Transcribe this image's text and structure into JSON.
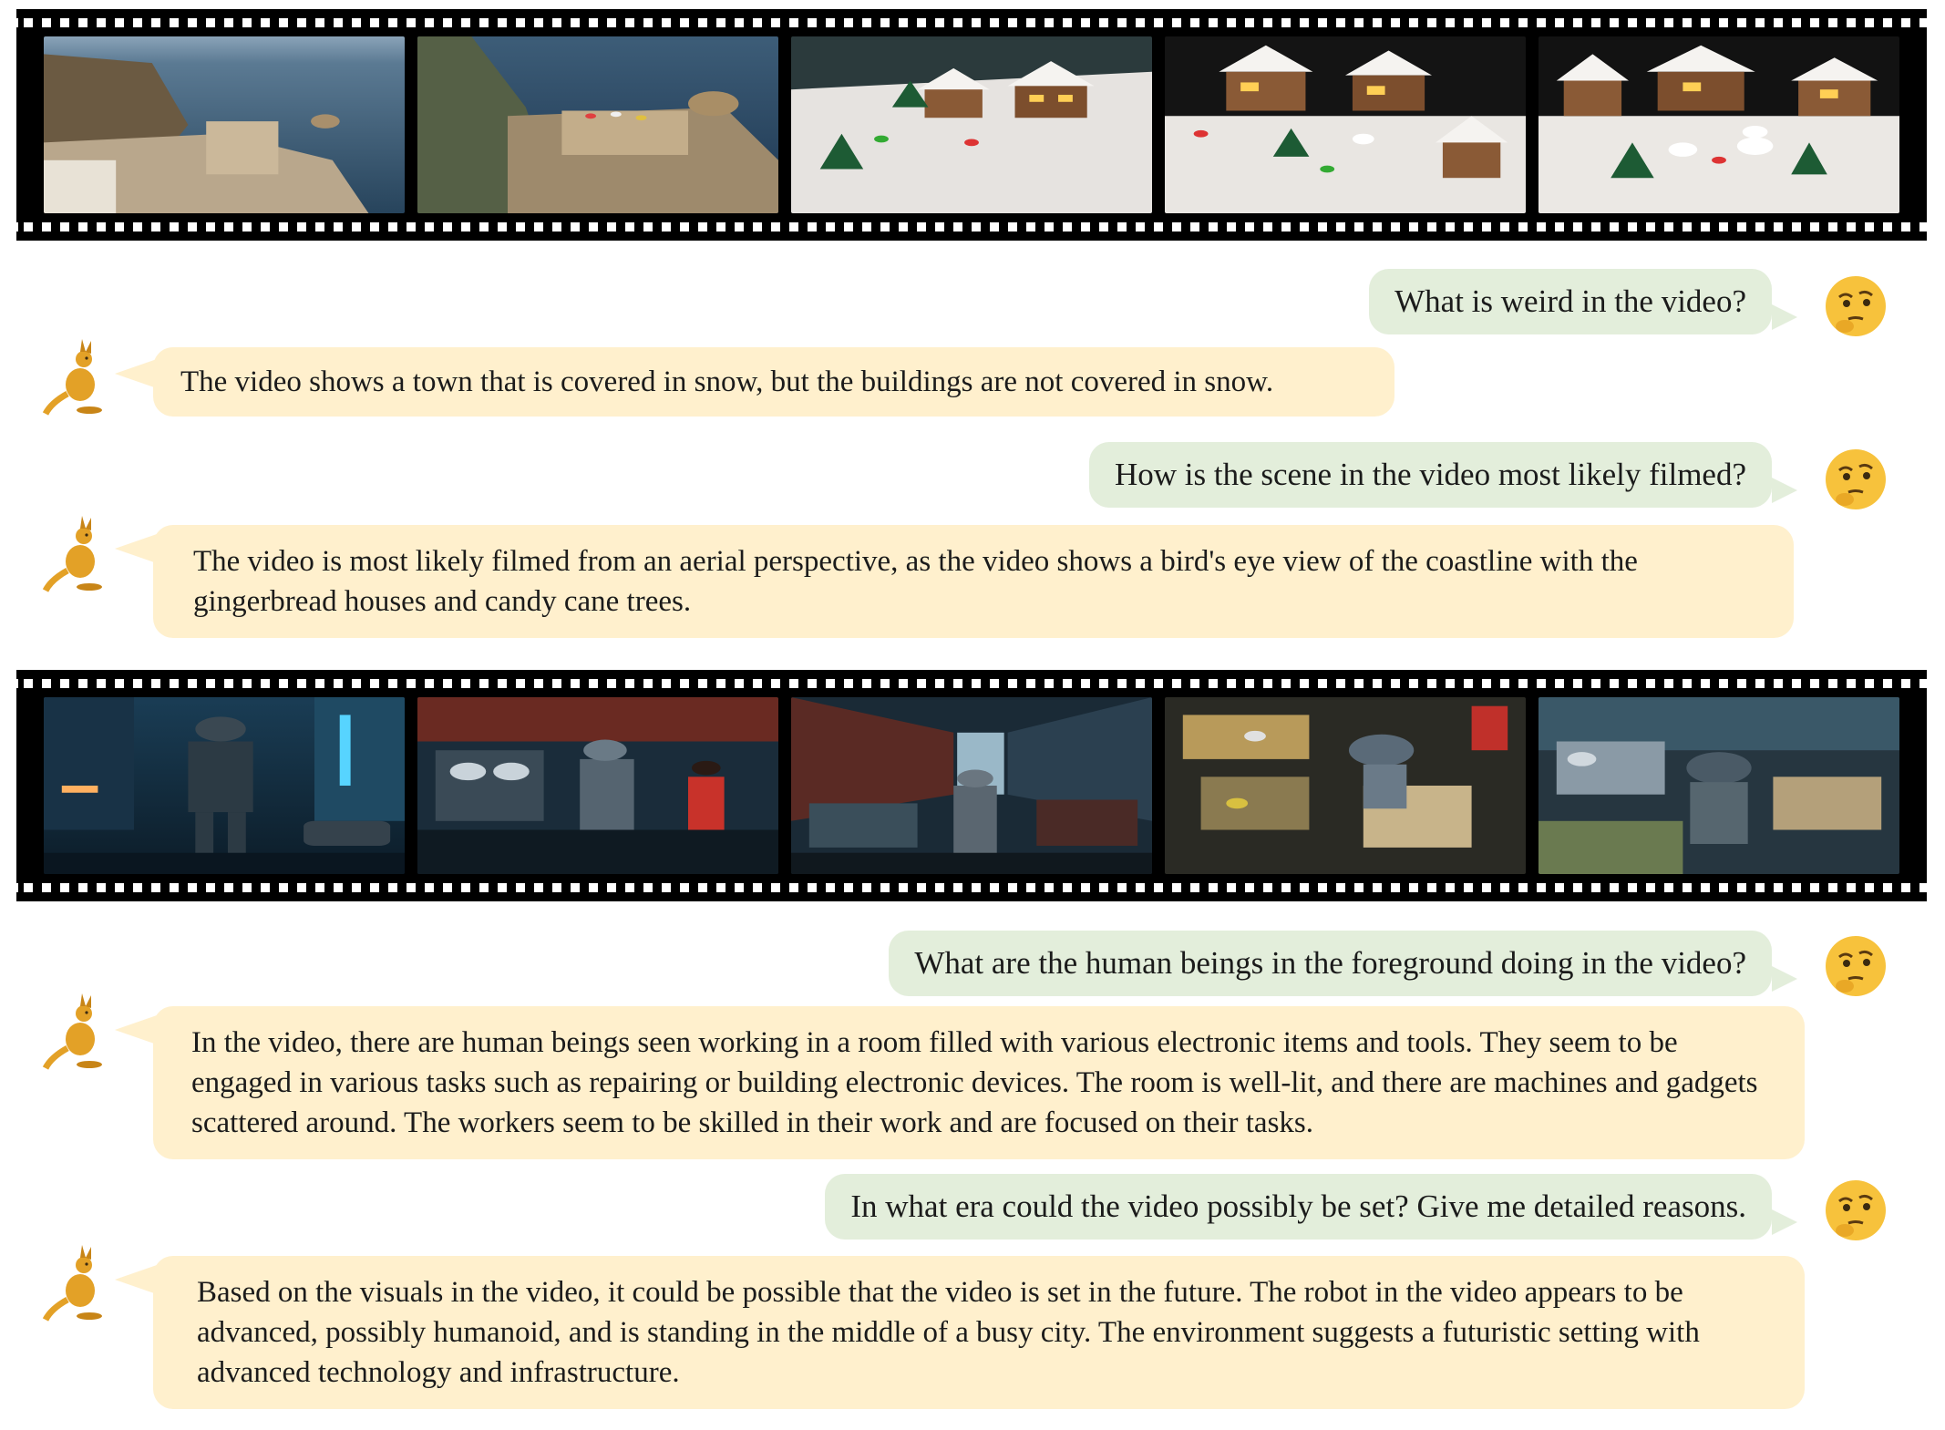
{
  "strips": [
    {
      "name": "film-strip-1",
      "frames": [
        {
          "label": "coastline-aerial"
        },
        {
          "label": "coastal-castle"
        },
        {
          "label": "gingerbread-coast"
        },
        {
          "label": "gingerbread-village"
        },
        {
          "label": "gingerbread-snowmen"
        }
      ]
    },
    {
      "name": "film-strip-2",
      "frames": [
        {
          "label": "robot-city-street"
        },
        {
          "label": "robot-workshop"
        },
        {
          "label": "market-alley"
        },
        {
          "label": "workbench-topdown"
        },
        {
          "label": "robot-workbench"
        }
      ]
    }
  ],
  "chat": [
    {
      "role": "user",
      "text": "What is weird in the video?"
    },
    {
      "role": "assistant",
      "text": "The video shows a town that is covered in snow, but the buildings are not covered in snow."
    },
    {
      "role": "user",
      "text": "How is the scene in the video most likely filmed?"
    },
    {
      "role": "assistant",
      "text": "The video is most likely filmed from an aerial perspective, as the video shows a bird's eye view of the coastline with the gingerbread houses and candy cane trees."
    },
    {
      "role": "user",
      "text": "What are the human beings in the foreground doing in the video?"
    },
    {
      "role": "assistant",
      "text": "In the video, there are human beings seen working in a room filled with various electronic items and tools. They seem to be engaged in various tasks such as repairing or building electronic devices. The room is well-lit, and there are machines and gadgets scattered around. The workers seem to be skilled in their work and are focused on their tasks."
    },
    {
      "role": "user",
      "text": "In what era could the video possibly be set? Give me detailed reasons."
    },
    {
      "role": "assistant",
      "text": "Based on the visuals in the video, it could be possible that the video is set in the future. The robot in the video appears to be advanced, possibly humanoid, and is standing in the middle of a busy city. The environment suggests a futuristic setting with advanced technology and infrastructure."
    }
  ],
  "avatars": {
    "user": "thinking-face-emoji",
    "assistant": "kangaroo-emoji"
  },
  "colors": {
    "user_bubble": "#e3eedb",
    "assistant_bubble": "#fff0cd",
    "film": "#000000"
  }
}
